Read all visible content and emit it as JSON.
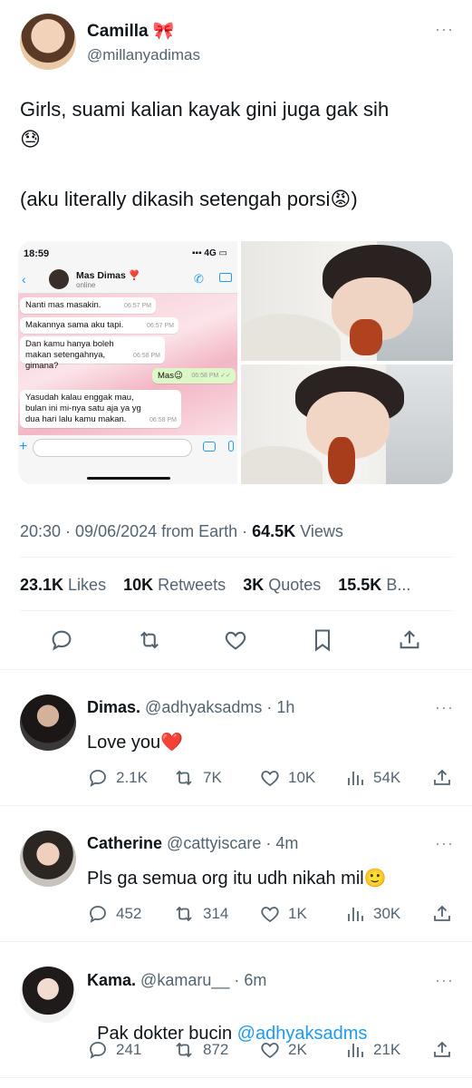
{
  "tweet": {
    "author_name": "Camilla",
    "author_emoji": "🎀",
    "handle": "@millanyadimas",
    "text_line1": "Girls, suami kalian kayak gini juga gak sih",
    "text_emoji1": "😓",
    "text_line2": "(aku literally dikasih setengah porsi",
    "text_emoji2": "😡",
    "text_line2_end": ")",
    "time": "20:30 · 09/06/2024 from Earth · ",
    "views_count": "64.5K",
    "views_label": " Views",
    "likes_count": "23.1K",
    "likes_label": " Likes",
    "retweets_count": "10K",
    "retweets_label": " Retweets",
    "quotes_count": "3K",
    "quotes_label": " Quotes",
    "bookmarks_count": "15.5K",
    "bookmarks_label": " B..."
  },
  "chat_screenshot": {
    "status_time": "18:59",
    "signal": "4G",
    "contact": "Mas Dimas",
    "contact_emoji": "❣️",
    "status": "online",
    "messages": [
      {
        "text": "Nanti mas masakin.",
        "time": "06:57 PM"
      },
      {
        "text": "Makannya sama aku tapi.",
        "time": "06:57 PM"
      },
      {
        "text": "Dan kamu hanya boleh makan setengahnya, gimana?",
        "time": "06:58 PM"
      },
      {
        "text": "Mas😉",
        "time": "06:58 PM ✓✓"
      },
      {
        "text": "Yasudah kalau enggak mau, bulan ini mi-nya satu aja ya yg dua hari lalu kamu makan.",
        "time": "06:58 PM"
      }
    ]
  },
  "replies": [
    {
      "name": "Dimas.",
      "handle": "@adhyaksadms",
      "time": "· 1h",
      "text": "Love you",
      "emoji": "❤️",
      "link": "",
      "replies": "2.1K",
      "retweets": "7K",
      "likes": "10K",
      "views": "54K"
    },
    {
      "name": "Catherine",
      "handle": "@cattyiscare",
      "time": "· 4m",
      "text": "Pls ga semua org itu udh nikah mil",
      "emoji": "🙂",
      "link": "",
      "replies": "452",
      "retweets": "314",
      "likes": "1K",
      "views": "30K"
    },
    {
      "name": "Kama.",
      "handle": "@kamaru__",
      "time": "· 6m",
      "text": "Pak dokter bucin ",
      "emoji": "",
      "link": "@adhyaksadms",
      "replies": "241",
      "retweets": "872",
      "likes": "2K",
      "views": "21K"
    }
  ],
  "colors": {
    "accent": "#1d9bf0",
    "text": "#0f1419",
    "muted": "#536471",
    "divider": "#eff3f4"
  }
}
